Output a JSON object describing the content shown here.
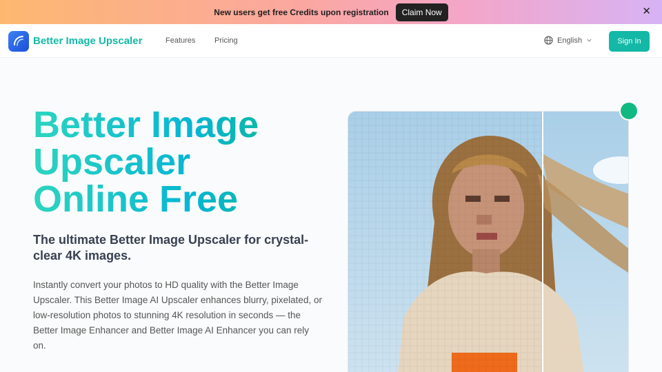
{
  "promo": {
    "text": "New users get free Credits upon registration",
    "button_label": "Claim Now",
    "close_icon": "close-icon"
  },
  "nav": {
    "brand": "Better Image Upscaler",
    "links": [
      "Features",
      "Pricing"
    ],
    "language": "English",
    "signin_label": "Sign In"
  },
  "hero": {
    "title_lines": [
      "Better Image",
      "Upscaler",
      "Online Free"
    ],
    "subtitle": "The ultimate Better Image Upscaler for crystal-clear 4K images.",
    "description": "Instantly convert your photos to HD quality with the Better Image Upscaler. This Better Image AI Upscaler enhances blurry, pixelated, or low-resolution photos to stunning 4K resolution in seconds — the Better Image Enhancer and Better Image AI Enhancer you can rely on."
  },
  "colors": {
    "accent": "#14b8a6",
    "promo_button": "#222222"
  }
}
